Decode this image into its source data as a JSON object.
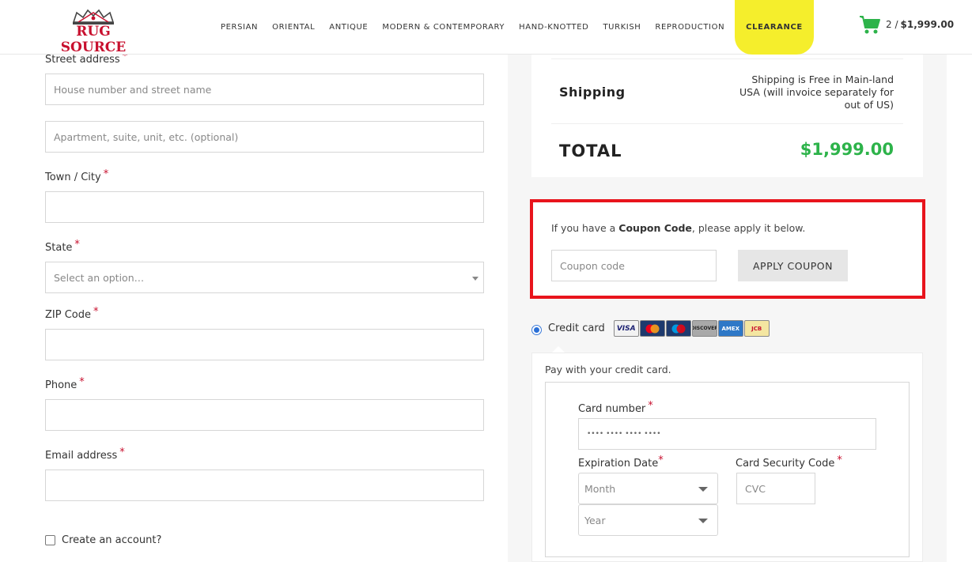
{
  "header": {
    "logo_text": "RUG SOURCE",
    "nav": [
      "PERSIAN",
      "ORIENTAL",
      "ANTIQUE",
      "MODERN & CONTEMPORARY",
      "HAND-KNOTTED",
      "TURKISH",
      "REPRODUCTION",
      "CLEARANCE"
    ],
    "cart_count": "2 /",
    "cart_total": "$1,999.00"
  },
  "billing": {
    "street_label": "Street address",
    "street_placeholder": "House number and street name",
    "apartment_placeholder": "Apartment, suite, unit, etc. (optional)",
    "city_label": "Town / City",
    "state_label": "State",
    "state_placeholder": "Select an option…",
    "zip_label": "ZIP Code",
    "phone_label": "Phone",
    "email_label": "Email address",
    "required_mark": "*",
    "create_account_label": "Create an account?"
  },
  "totals": {
    "shipping_label": "Shipping",
    "shipping_value": "Shipping is Free in Main-land USA (will invoice separately for out of US)",
    "total_label": "TOTAL",
    "total_value": "$1,999.00"
  },
  "coupon": {
    "text_before": "If you have a ",
    "text_bold": "Coupon Code",
    "text_after": ", please apply it below.",
    "placeholder": "Coupon code",
    "button": "APPLY COUPON"
  },
  "payment": {
    "method_label": "Credit card",
    "card_brands": [
      "VISA",
      "MC",
      "MAESTRO",
      "DISCOVER",
      "AMEX",
      "JCB"
    ],
    "description": "Pay with your credit card.",
    "card_number_label": "Card number",
    "card_number_placeholder": "•••• •••• •••• ••••",
    "expiration_label": "Expiration Date",
    "month_placeholder": "Month",
    "year_placeholder": "Year",
    "cvc_label": "Card Security Code",
    "cvc_placeholder": "CVC"
  },
  "colors": {
    "brand_red": "#c8102e",
    "clearance_yellow": "#f5ee2c",
    "cart_green": "#2db34a",
    "coupon_border": "#e8141c"
  }
}
